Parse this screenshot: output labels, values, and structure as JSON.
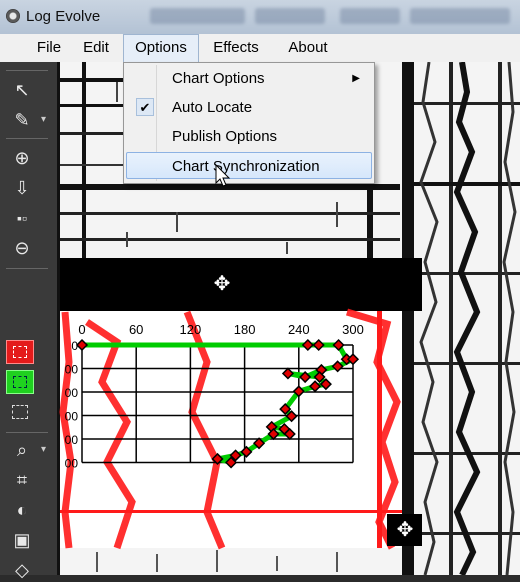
{
  "window": {
    "title": "Log Evolve"
  },
  "menubar": {
    "items": [
      "File",
      "Edit",
      "Options",
      "Effects",
      "About"
    ],
    "open_menu": "Options"
  },
  "options_menu": {
    "items": [
      {
        "label": "Chart Options",
        "has_submenu": true,
        "checked": false
      },
      {
        "label": "Auto Locate",
        "has_submenu": false,
        "checked": true
      },
      {
        "label": "Publish Options",
        "has_submenu": false,
        "checked": false
      },
      {
        "label": "Chart Synchronization",
        "has_submenu": false,
        "checked": false,
        "highlighted": true
      }
    ]
  },
  "toolbar": {
    "tools": [
      "pan-tool",
      "pen-tool",
      "zoom-in",
      "move-down",
      "nodes-tool",
      "zoom-out",
      "red-region-select",
      "green-region-select",
      "rect-select",
      "magnifier-tool",
      "crop-tool",
      "brightness-tool",
      "stack-tool",
      "diamond-tool"
    ]
  },
  "chart_data": {
    "type": "scatter",
    "x_ticks": [
      "0",
      "60",
      "120",
      "180",
      "240",
      "300"
    ],
    "xlim": [
      0,
      300
    ],
    "y_tick_labels": [
      "0",
      "00",
      "00",
      "00",
      "00",
      "00"
    ],
    "colors": {
      "grid": "#000000",
      "line": "#00cc00",
      "markers": "#e00000",
      "overlay_curve": "#ff1a1a"
    },
    "points": [
      [
        0,
        0
      ],
      [
        250,
        0
      ],
      [
        262,
        0
      ],
      [
        284,
        0
      ],
      [
        293,
        20
      ],
      [
        300,
        20
      ],
      [
        283,
        30
      ],
      [
        265,
        35
      ],
      [
        247,
        45
      ],
      [
        228,
        40
      ],
      [
        263,
        45
      ],
      [
        270,
        55
      ],
      [
        258,
        58
      ],
      [
        240,
        65
      ],
      [
        225,
        90
      ],
      [
        232,
        100
      ],
      [
        210,
        115
      ],
      [
        224,
        118
      ],
      [
        230,
        125
      ],
      [
        212,
        125
      ],
      [
        196,
        138
      ],
      [
        182,
        150
      ],
      [
        170,
        155
      ],
      [
        150,
        160
      ],
      [
        165,
        165
      ]
    ]
  }
}
